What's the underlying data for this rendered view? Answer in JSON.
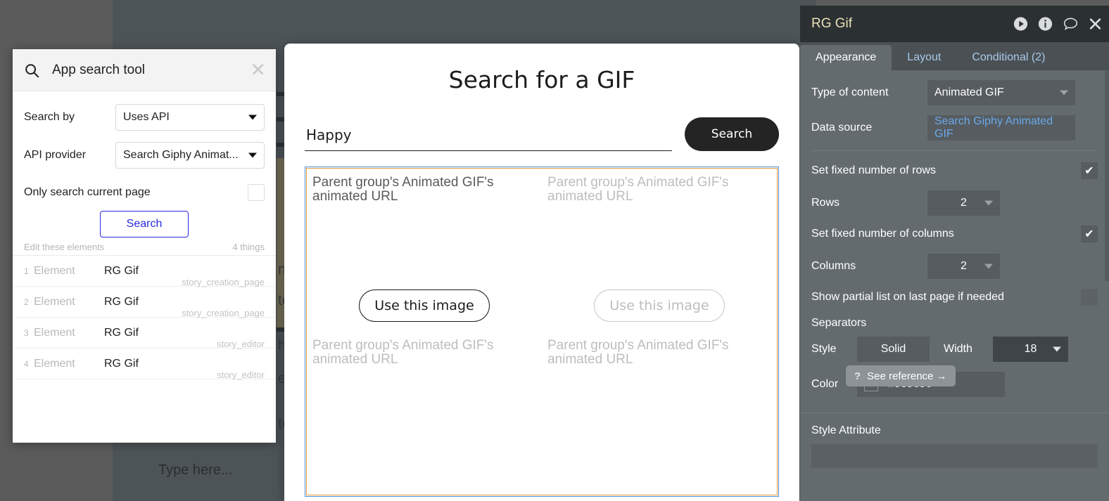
{
  "background": {
    "type_here_text": "Type here...",
    "edge_texts": [
      "n",
      "to",
      "h",
      "e",
      "te"
    ]
  },
  "app_search_tool": {
    "title": "App search tool",
    "close_icon": "close-icon",
    "search_icon": "search-icon",
    "fields": [
      {
        "label": "Search by",
        "value": "Uses API"
      },
      {
        "label": "API provider",
        "value": "Search Giphy Animat..."
      }
    ],
    "checkbox_label": "Only search current page",
    "checkbox_checked": false,
    "search_button": "Search",
    "list_header_left": "Edit these elements",
    "list_header_right": "4 things",
    "results": [
      {
        "index": "1",
        "kind": "Element",
        "name": "RG Gif",
        "page": "story_creation_page"
      },
      {
        "index": "2",
        "kind": "Element",
        "name": "RG Gif",
        "page": "story_creation_page"
      },
      {
        "index": "3",
        "kind": "Element",
        "name": "RG Gif",
        "page": "story_editor"
      },
      {
        "index": "4",
        "kind": "Element",
        "name": "RG Gif",
        "page": "story_editor"
      }
    ]
  },
  "gif_modal": {
    "title": "Search for a GIF",
    "input_value": "Happy",
    "input_placeholder": "",
    "search_button": "Search",
    "cells": [
      {
        "placeholder": "Parent group's Animated GIF's animated URL",
        "button": "Use this image",
        "primary": true,
        "has_button": true
      },
      {
        "placeholder": "Parent group's Animated GIF's animated URL",
        "button": "Use this image",
        "primary": false,
        "has_button": true
      },
      {
        "placeholder": "Parent group's Animated GIF's animated URL",
        "button": "Use this image",
        "primary": false,
        "has_button": false
      },
      {
        "placeholder": "Parent group's Animated GIF's animated URL",
        "button": "Use this image",
        "primary": false,
        "has_button": false
      }
    ],
    "grid_outer_border_color": "#4d90d9",
    "grid_inner_border_color": "#e79a3c"
  },
  "properties_panel": {
    "title": "RG Gif",
    "title_color": "#ebe0b7",
    "header_icons": [
      "play-icon",
      "info-icon",
      "comment-icon",
      "close-icon"
    ],
    "tabs": [
      {
        "label": "Appearance",
        "active": true
      },
      {
        "label": "Layout",
        "active": false
      },
      {
        "label": "Conditional (2)",
        "active": false
      }
    ],
    "type_of_content": {
      "label": "Type of content",
      "value": "Animated GIF"
    },
    "data_source": {
      "label": "Data source",
      "value": "Search Giphy Animated GIF",
      "color": "#6aa9e9"
    },
    "fixed_rows": {
      "label": "Set fixed number of rows",
      "checked": true
    },
    "rows": {
      "label": "Rows",
      "value": "2"
    },
    "fixed_columns": {
      "label": "Set fixed number of columns",
      "checked": true
    },
    "columns": {
      "label": "Columns",
      "value": "2"
    },
    "partial_list": {
      "label": "Show partial list on last page if needed",
      "checked": false
    },
    "separators_label": "Separators",
    "style": {
      "label": "Style",
      "value": "Solid"
    },
    "width": {
      "label": "Width",
      "value": "18"
    },
    "color": {
      "label": "Color",
      "value": "#969696"
    },
    "style_attribute_label": "Style Attribute",
    "tooltip": {
      "icon": "question-mark-icon",
      "text": "See reference →"
    }
  }
}
